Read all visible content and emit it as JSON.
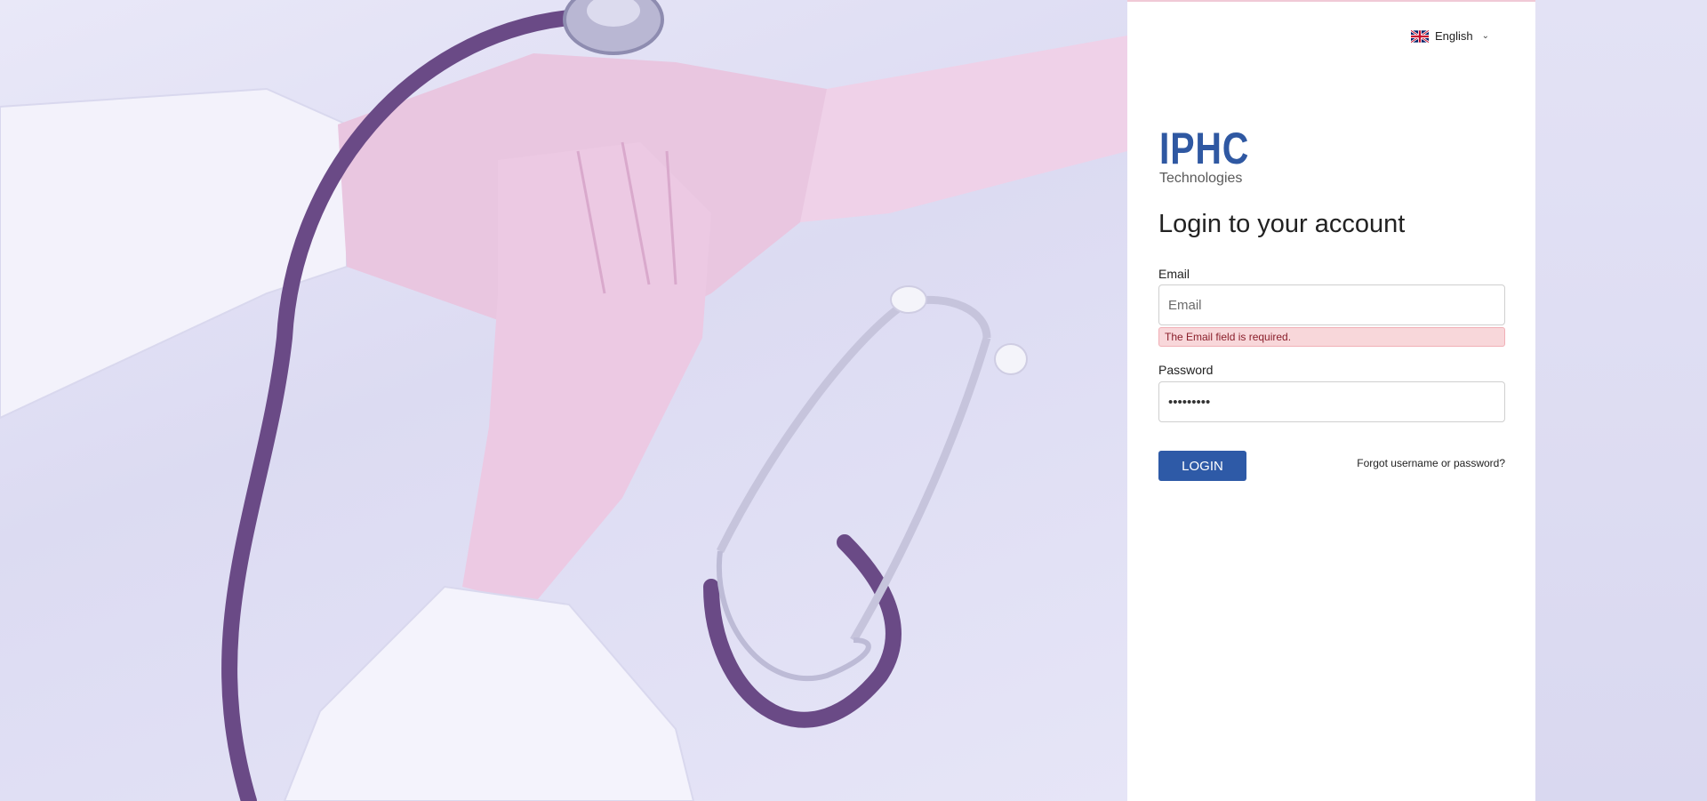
{
  "language": {
    "label": "English",
    "flag": "uk-flag-icon"
  },
  "brand": {
    "name": "IPHC",
    "tagline": "Technologies",
    "color": "#2f58a2"
  },
  "login": {
    "title": "Login to your account",
    "email_label": "Email",
    "email_placeholder": "Email",
    "email_value": "",
    "email_error": "The Email field is required.",
    "password_label": "Password",
    "password_value": "password1",
    "submit_label": "LOGIN",
    "forgot_label": "Forgot username or password?"
  },
  "colors": {
    "accent": "#2e5aa7",
    "error_bg": "#f8d7da",
    "error_text": "#8a1f2b"
  }
}
